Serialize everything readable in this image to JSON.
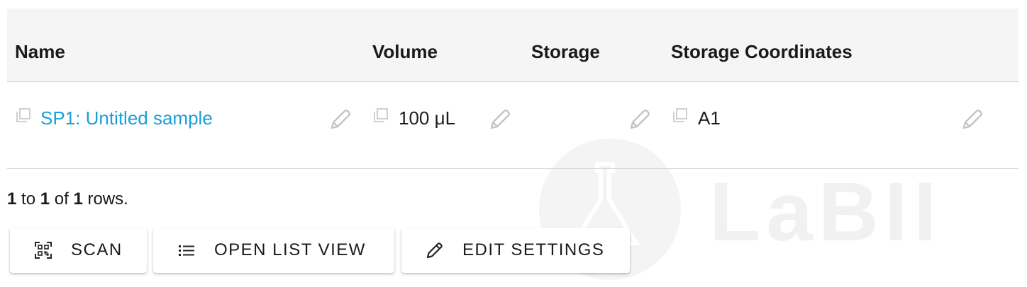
{
  "table": {
    "columns": {
      "name": "Name",
      "volume": "Volume",
      "storage": "Storage",
      "storage_coordinates": "Storage Coordinates"
    },
    "rows": [
      {
        "name": "SP1: Untitled sample",
        "volume": "100 μL",
        "storage": "",
        "storage_coordinates": "A1"
      }
    ]
  },
  "pagination": {
    "start": "1",
    "to": "to",
    "end": "1",
    "of": "of",
    "total": "1",
    "suffix": "rows."
  },
  "toolbar": {
    "scan_label": "SCAN",
    "open_list_view_label": "OPEN LIST VIEW",
    "edit_settings_label": "EDIT SETTINGS"
  },
  "watermark": {
    "text": "LaBII"
  },
  "colors": {
    "link": "#1a9fd9",
    "header_bg": "#f5f5f5",
    "icon_gray": "#c4c4c4"
  },
  "icons": [
    "copy-icon",
    "pencil-icon",
    "qr-scan-icon",
    "list-icon",
    "edit-pencil-icon",
    "flask-icon"
  ]
}
